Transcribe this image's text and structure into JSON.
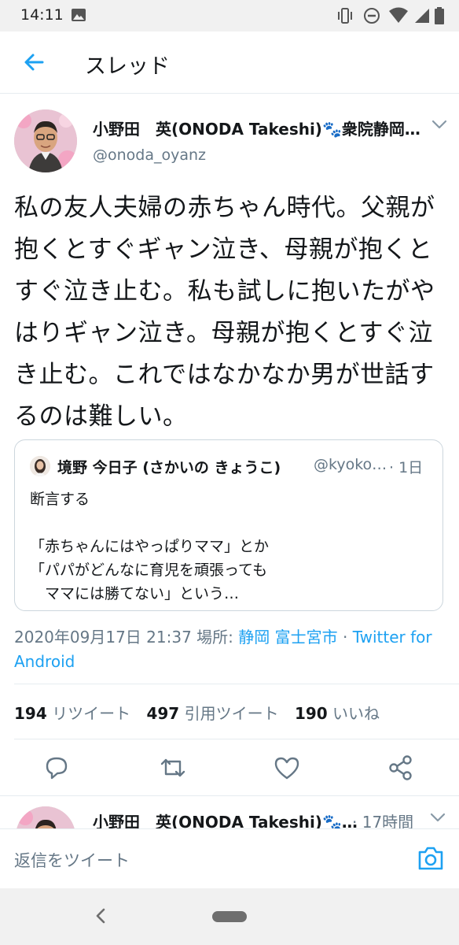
{
  "status_bar": {
    "time": "14:11"
  },
  "app_bar": {
    "title": "スレッド"
  },
  "tweet": {
    "author_name": "小野田　英(ONODA Takeshi)🐾衆院静岡…",
    "handle": "@onoda_oyanz",
    "text": "私の友人夫婦の赤ちゃん時代。父親が抱くとすぐギャン泣き、母親が抱くとすぐ泣き止む。私も試しに抱いたがやはりギャン泣き。母親が抱くとすぐ泣き止む。これではなかなか男が世話するのは難しい。",
    "quote": {
      "author_name": "境野 今日子 (さかいの きょうこ)",
      "handle": "@kyoko…",
      "time": "· 1日",
      "lines": [
        "断言する",
        "",
        "「赤ちゃんにはやっぱりママ」とか",
        "「パパがどんなに育児を頑張っても",
        "　ママには勝てない」という…"
      ]
    },
    "meta": {
      "datetime": "2020年09月17日 21:37",
      "location_label": " 場所: ",
      "location": "静岡 富士宮市",
      "separator": " · ",
      "source_line1": "Twitter for",
      "source_line2": "Android"
    },
    "stats": {
      "retweets_count": "194",
      "retweets_label": " リツイート",
      "quotes_count": "497",
      "quotes_label": " 引用ツイート",
      "likes_count": "190",
      "likes_label": " いいね"
    },
    "actions": {
      "reply_icon": "reply-icon",
      "retweet_icon": "retweet-icon",
      "like_icon": "heart-icon",
      "share_icon": "share-icon"
    }
  },
  "next_reply": {
    "author_name": "小野田　英(ONODA Takeshi)🐾…",
    "time": "· 17時間"
  },
  "compose": {
    "placeholder": "返信をツイート"
  },
  "colors": {
    "accent": "#1da1f2",
    "secondary_text": "#657786",
    "border": "#e6ecf0"
  }
}
